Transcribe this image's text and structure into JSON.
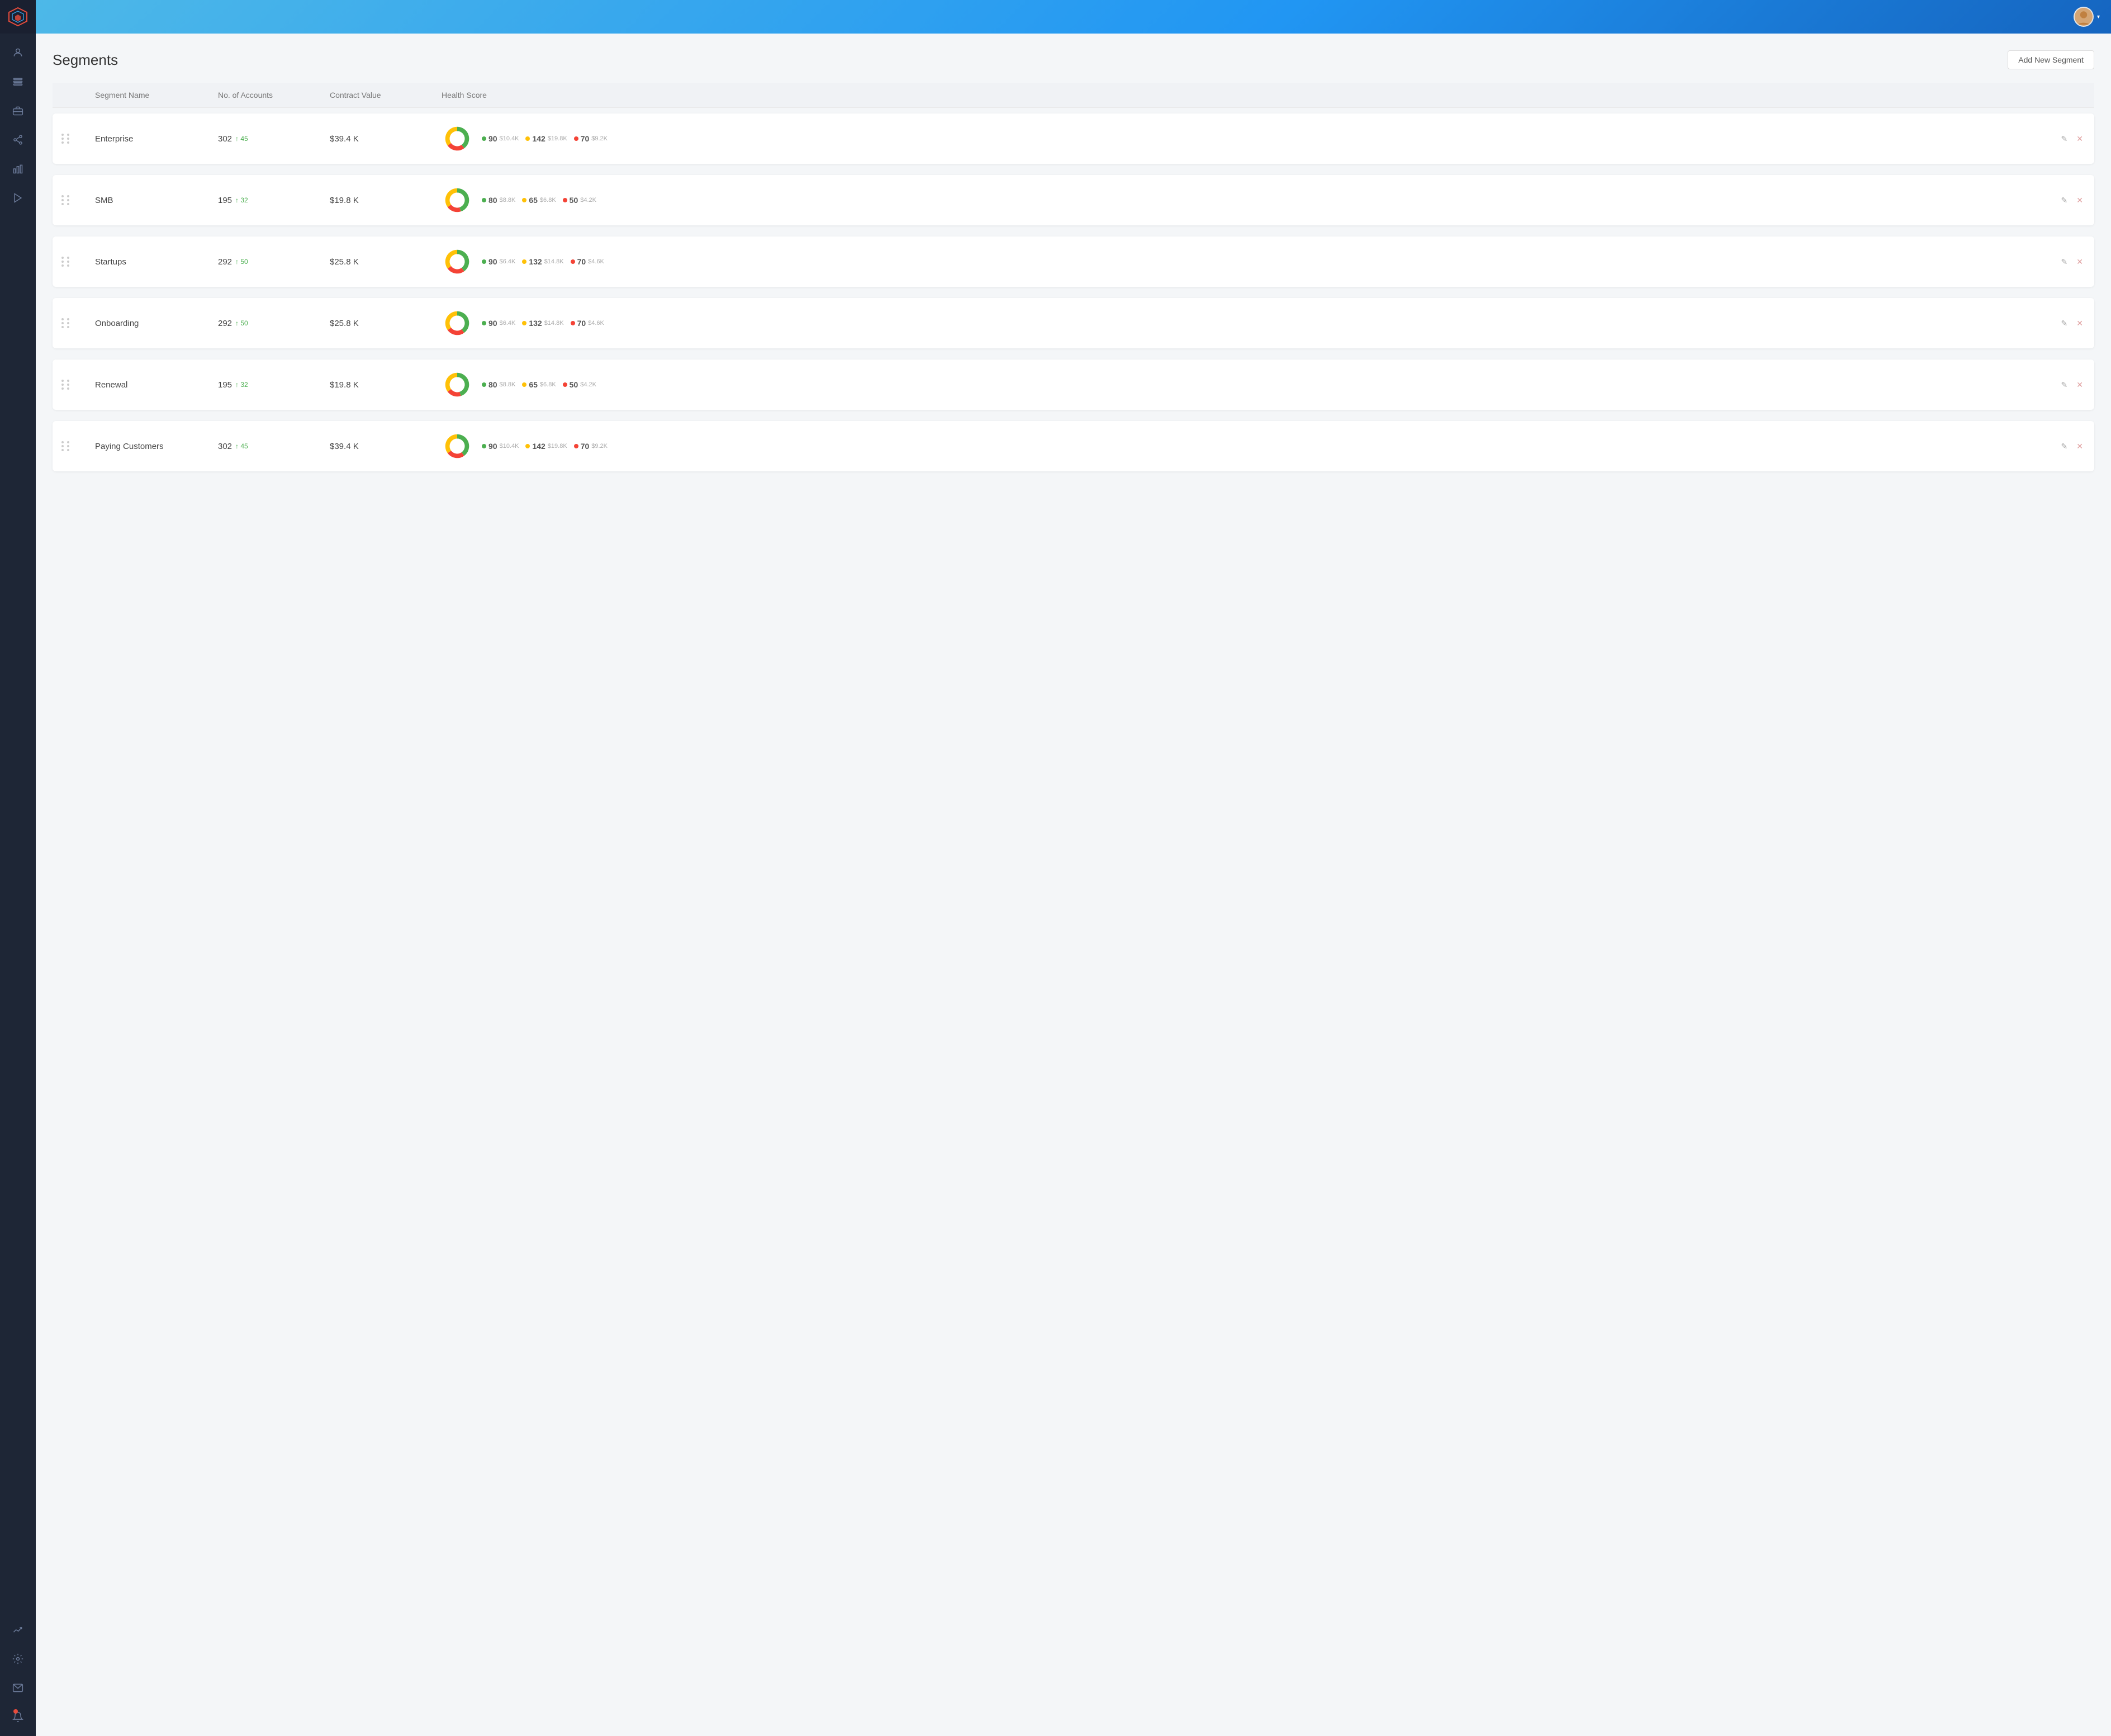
{
  "app": {
    "title": "Segments"
  },
  "header": {
    "add_button_label": "Add New Segment"
  },
  "table": {
    "columns": [
      "",
      "Segment Name",
      "No. of Accounts",
      "Contract Value",
      "Health Score"
    ],
    "rows": [
      {
        "id": "enterprise",
        "name": "Enterprise",
        "accounts": "302",
        "accounts_delta": "↑ 45",
        "contract_value": "$39.4 K",
        "health": {
          "donut": {
            "green": 40,
            "red": 25,
            "yellow": 35
          },
          "scores": [
            {
              "color": "#4caf50",
              "value": "90",
              "amount": "$10.4K"
            },
            {
              "color": "#ffc107",
              "value": "142",
              "amount": "$19.8K"
            },
            {
              "color": "#f44336",
              "value": "70",
              "amount": "$9.2K"
            }
          ]
        }
      },
      {
        "id": "smb",
        "name": "SMB",
        "accounts": "195",
        "accounts_delta": "↑ 32",
        "contract_value": "$19.8 K",
        "health": {
          "donut": {
            "green": 45,
            "red": 20,
            "yellow": 35
          },
          "scores": [
            {
              "color": "#4caf50",
              "value": "80",
              "amount": "$8.8K"
            },
            {
              "color": "#ffc107",
              "value": "65",
              "amount": "$6.8K"
            },
            {
              "color": "#f44336",
              "value": "50",
              "amount": "$4.2K"
            }
          ]
        }
      },
      {
        "id": "startups",
        "name": "Startups",
        "accounts": "292",
        "accounts_delta": "↑ 50",
        "contract_value": "$25.8 K",
        "health": {
          "donut": {
            "green": 40,
            "red": 25,
            "yellow": 35
          },
          "scores": [
            {
              "color": "#4caf50",
              "value": "90",
              "amount": "$6.4K"
            },
            {
              "color": "#ffc107",
              "value": "132",
              "amount": "$14.8K"
            },
            {
              "color": "#f44336",
              "value": "70",
              "amount": "$4.6K"
            }
          ]
        }
      },
      {
        "id": "onboarding",
        "name": "Onboarding",
        "accounts": "292",
        "accounts_delta": "↑ 50",
        "contract_value": "$25.8 K",
        "health": {
          "donut": {
            "green": 40,
            "red": 25,
            "yellow": 35
          },
          "scores": [
            {
              "color": "#4caf50",
              "value": "90",
              "amount": "$6.4K"
            },
            {
              "color": "#ffc107",
              "value": "132",
              "amount": "$14.8K"
            },
            {
              "color": "#f44336",
              "value": "70",
              "amount": "$4.6K"
            }
          ]
        }
      },
      {
        "id": "renewal",
        "name": "Renewal",
        "accounts": "195",
        "accounts_delta": "↑ 32",
        "contract_value": "$19.8 K",
        "health": {
          "donut": {
            "green": 45,
            "red": 20,
            "yellow": 35
          },
          "scores": [
            {
              "color": "#4caf50",
              "value": "80",
              "amount": "$8.8K"
            },
            {
              "color": "#ffc107",
              "value": "65",
              "amount": "$6.8K"
            },
            {
              "color": "#f44336",
              "value": "50",
              "amount": "$4.2K"
            }
          ]
        }
      },
      {
        "id": "paying-customers",
        "name": "Paying Customers",
        "accounts": "302",
        "accounts_delta": "↑ 45",
        "contract_value": "$39.4 K",
        "health": {
          "donut": {
            "green": 40,
            "red": 25,
            "yellow": 35
          },
          "scores": [
            {
              "color": "#4caf50",
              "value": "90",
              "amount": "$10.4K"
            },
            {
              "color": "#ffc107",
              "value": "142",
              "amount": "$19.8K"
            },
            {
              "color": "#f44336",
              "value": "70",
              "amount": "$9.2K"
            }
          ]
        }
      }
    ]
  },
  "sidebar": {
    "items": [
      {
        "id": "user",
        "icon": "user-icon"
      },
      {
        "id": "list",
        "icon": "list-icon"
      },
      {
        "id": "briefcase",
        "icon": "briefcase-icon"
      },
      {
        "id": "share",
        "icon": "share-icon"
      },
      {
        "id": "chart-bar",
        "icon": "chart-bar-icon"
      },
      {
        "id": "play",
        "icon": "play-icon"
      }
    ],
    "bottom_items": [
      {
        "id": "chart-analytics",
        "icon": "chart-analytics-icon"
      },
      {
        "id": "settings",
        "icon": "settings-icon"
      },
      {
        "id": "mail",
        "icon": "mail-icon"
      },
      {
        "id": "notification",
        "icon": "notification-icon",
        "has_badge": true
      }
    ]
  }
}
